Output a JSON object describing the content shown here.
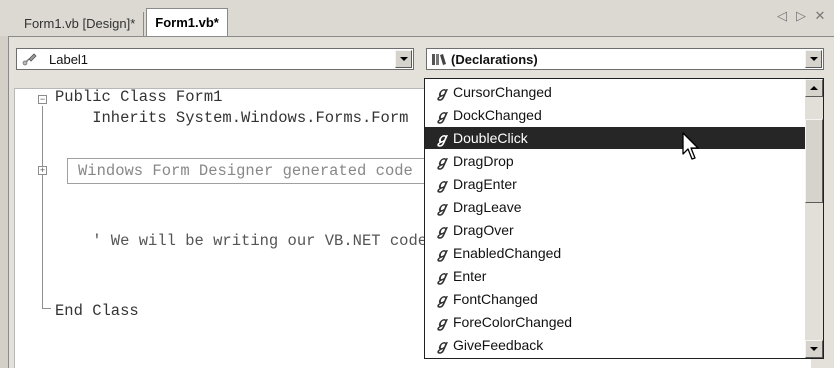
{
  "tabs": [
    {
      "label": "Form1.vb [Design]*"
    },
    {
      "label": "Form1.vb*"
    }
  ],
  "nav": {
    "left": "◁",
    "right": "▷",
    "close": "✕"
  },
  "object_combo": {
    "value": "Label1",
    "icon": "control-icon"
  },
  "event_combo": {
    "value": "(Declarations)",
    "icon": "declarations-icon"
  },
  "code": {
    "lines": [
      "Public Class Form1",
      "    Inherits System.Windows.Forms.Form",
      "",
      "",
      "",
      "    ' We will be writing our VB.NET code here",
      "",
      "",
      "End Class"
    ],
    "region": "Windows Form Designer generated code",
    "expand_plus": "+",
    "collapse_minus": "−"
  },
  "event_list": {
    "items": [
      "CursorChanged",
      "DockChanged",
      "DoubleClick",
      "DragDrop",
      "DragEnter",
      "DragLeave",
      "DragOver",
      "EnabledChanged",
      "Enter",
      "FontChanged",
      "ForeColorChanged",
      "GiveFeedback"
    ],
    "selected": "DoubleClick",
    "event_icon": "ℊ"
  },
  "colors": {
    "selection_bg": "#262626",
    "chrome_bg": "#d4d0c8"
  }
}
